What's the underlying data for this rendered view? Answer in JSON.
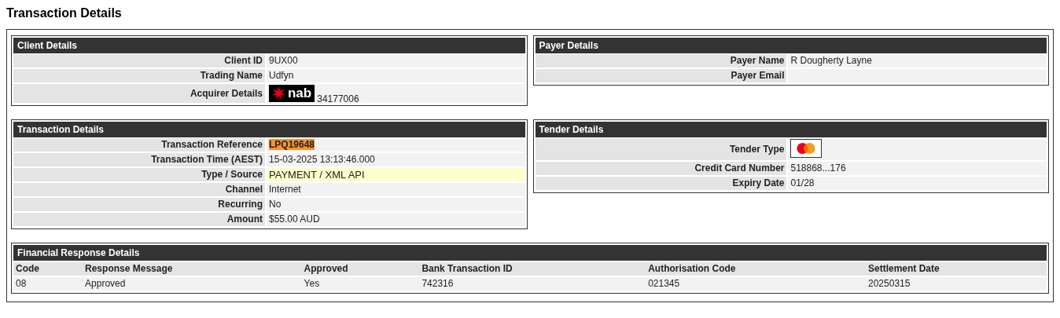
{
  "page_title": "Transaction Details",
  "panels": [
    {
      "title": "Client Details",
      "rows": [
        {
          "label": "Client ID",
          "kind": "text",
          "value": "9UX00"
        },
        {
          "label": "Trading Name",
          "kind": "text",
          "value": "Udfyn"
        },
        {
          "label": "Acquirer Details",
          "kind": "acquirer",
          "logo_text": "nab",
          "value": "34177006"
        }
      ]
    },
    {
      "title": "Payer Details",
      "rows": [
        {
          "label": "Payer Name",
          "kind": "text",
          "value": "R Dougherty Layne"
        },
        {
          "label": "Payer Email",
          "kind": "text"
        }
      ]
    },
    {
      "title": "Transaction Details",
      "rows": [
        {
          "label": "Transaction Reference",
          "kind": "highlight",
          "value": "LPQ19648"
        },
        {
          "label": "Transaction Time (AEST)",
          "kind": "text",
          "value": "15-03-2025 13:13:46.000"
        },
        {
          "label": "Type / Source",
          "kind": "emphasis",
          "value": "PAYMENT / XML API"
        },
        {
          "label": "Channel",
          "kind": "text",
          "value": "Internet"
        },
        {
          "label": "Recurring",
          "kind": "text",
          "value": "No"
        },
        {
          "label": "Amount",
          "kind": "text",
          "value": "$55.00 AUD"
        }
      ]
    },
    {
      "title": "Tender Details",
      "rows": [
        {
          "label": "Tender Type",
          "kind": "card"
        },
        {
          "label": "Credit Card Number",
          "kind": "text",
          "value": "518868...176"
        },
        {
          "label": "Expiry Date",
          "kind": "text",
          "value": "01/28"
        }
      ]
    }
  ],
  "financial": {
    "title": "Financial Response Details",
    "columns": [
      "Code",
      "Response Message",
      "Approved",
      "Bank Transaction ID",
      "Authorisation Code",
      "Settlement Date"
    ],
    "rows": [
      [
        "08",
        "Approved",
        "Yes",
        "742316",
        "021345",
        "20250315"
      ]
    ]
  }
}
